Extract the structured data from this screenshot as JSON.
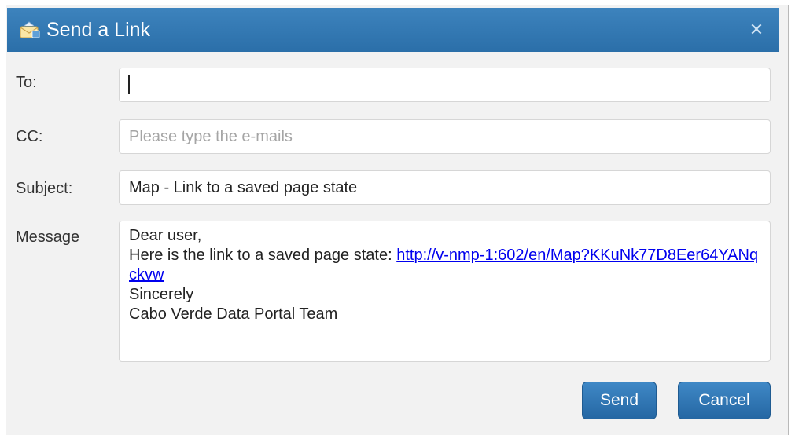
{
  "dialog": {
    "title": "Send a Link",
    "close_icon": "close-icon",
    "title_icon": "envelope-icon"
  },
  "form": {
    "to_label": "To:",
    "to_value": "",
    "cc_label": "CC:",
    "cc_placeholder": "Please type the e-mails",
    "subject_label": "Subject:",
    "subject_value": "Map - Link to a saved page state",
    "message_label": "Message",
    "message": {
      "greeting": "Dear user,",
      "intro": "Here is the link to a saved page state: ",
      "link_text": "http://v-nmp-1:602/en/Map?KKuNk77D8Eer64YANqckvw",
      "closing": "Sincerely",
      "signature": "Cabo Verde Data Portal Team"
    }
  },
  "buttons": {
    "send": "Send",
    "cancel": "Cancel"
  },
  "colors": {
    "titlebar": "#3d83bd",
    "button": "#2f78b8",
    "link": "#0000ee"
  }
}
